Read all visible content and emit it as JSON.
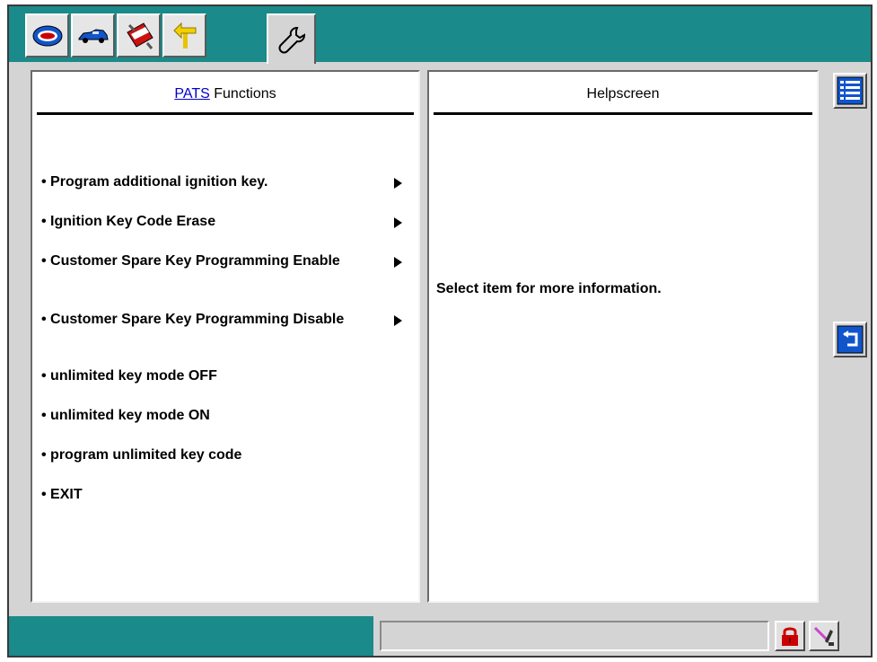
{
  "tabs": [
    {
      "icon": "wds-logo-icon"
    },
    {
      "icon": "vehicle-icon"
    },
    {
      "icon": "toolbox-icon"
    },
    {
      "icon": "signpost-arrow-icon"
    },
    {
      "icon": "wrench-icon",
      "active": true
    }
  ],
  "left_panel": {
    "title_link": "PATS",
    "title_rest": " Functions",
    "items": [
      {
        "label": "• Program additional ignition key.",
        "has_arrow": true
      },
      {
        "label": "• Ignition Key Code Erase",
        "has_arrow": true
      },
      {
        "label": "• Customer Spare Key Programming Enable",
        "has_arrow": true
      },
      {
        "label": "• Customer Spare Key Programming Disable",
        "has_arrow": true
      },
      {
        "label": "• unlimited key mode OFF",
        "has_arrow": false
      },
      {
        "label": "• unlimited key mode ON",
        "has_arrow": false
      },
      {
        "label": "• program unlimited key code",
        "has_arrow": false
      },
      {
        "label": "• EXIT",
        "has_arrow": false
      }
    ]
  },
  "right_panel": {
    "title": "Helpscreen",
    "body": "Select item for more information."
  },
  "side_buttons": [
    {
      "icon": "list-icon"
    },
    {
      "icon": "return-arrow-icon"
    }
  ],
  "status_bar": {
    "field_text": "",
    "icons": [
      "padlock-icon",
      "pen-icon"
    ]
  },
  "colors": {
    "teal": "#1a8a8a",
    "link_blue": "#0000cc",
    "panel_bg": "#d4d4d4",
    "icon_blue": "#1155cc",
    "lock_red": "#cc0000"
  }
}
